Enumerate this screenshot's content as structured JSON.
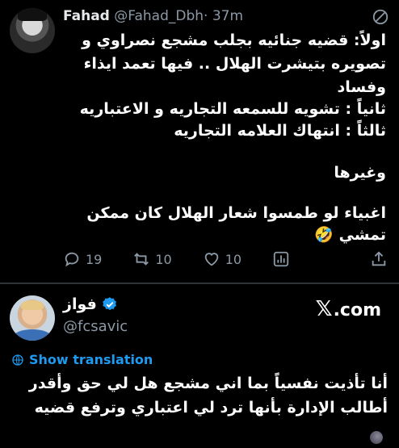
{
  "tweet1": {
    "author_name": "Fahad",
    "author_handle": "@Fahad_Dbh",
    "time": "· 37m",
    "lines": [
      "اولاً: قضيه جنائيه بجلب مشجع نصراوي و",
      "تصويره بتيشرت الهلال .. فيها تعمد ايذاء",
      "وفساد",
      "ثانياً : تشويه للسمعه التجاريه و الاعتباريه",
      "ثالثاً : انتهاك العلامه التجاريه",
      "وغيرها",
      "اغبياء لو طمسوا شعار الهلال كان ممكن",
      "تمشي 🤣"
    ],
    "actions": {
      "replies": "19",
      "retweets": "10",
      "likes": "10"
    },
    "icons": [
      "reply-icon",
      "retweet-icon",
      "like-icon",
      "stats-icon",
      "share-icon",
      "no-entry-icon"
    ]
  },
  "tweet2": {
    "author_name": "فواز",
    "author_handle": "@fcsavic",
    "brand": ".com",
    "brand_x": "𝕏",
    "show_translation": "Show translation",
    "lines": [
      "أنا تأذيت نفسياً بما اني مشجع هل لي حق وأقدر",
      "أطالب الإدارة بأنها ترد لي اعتباري وترفع قضيه"
    ],
    "colors": {
      "link": "#1d9bf0",
      "verified": "#1d9bf0"
    }
  }
}
